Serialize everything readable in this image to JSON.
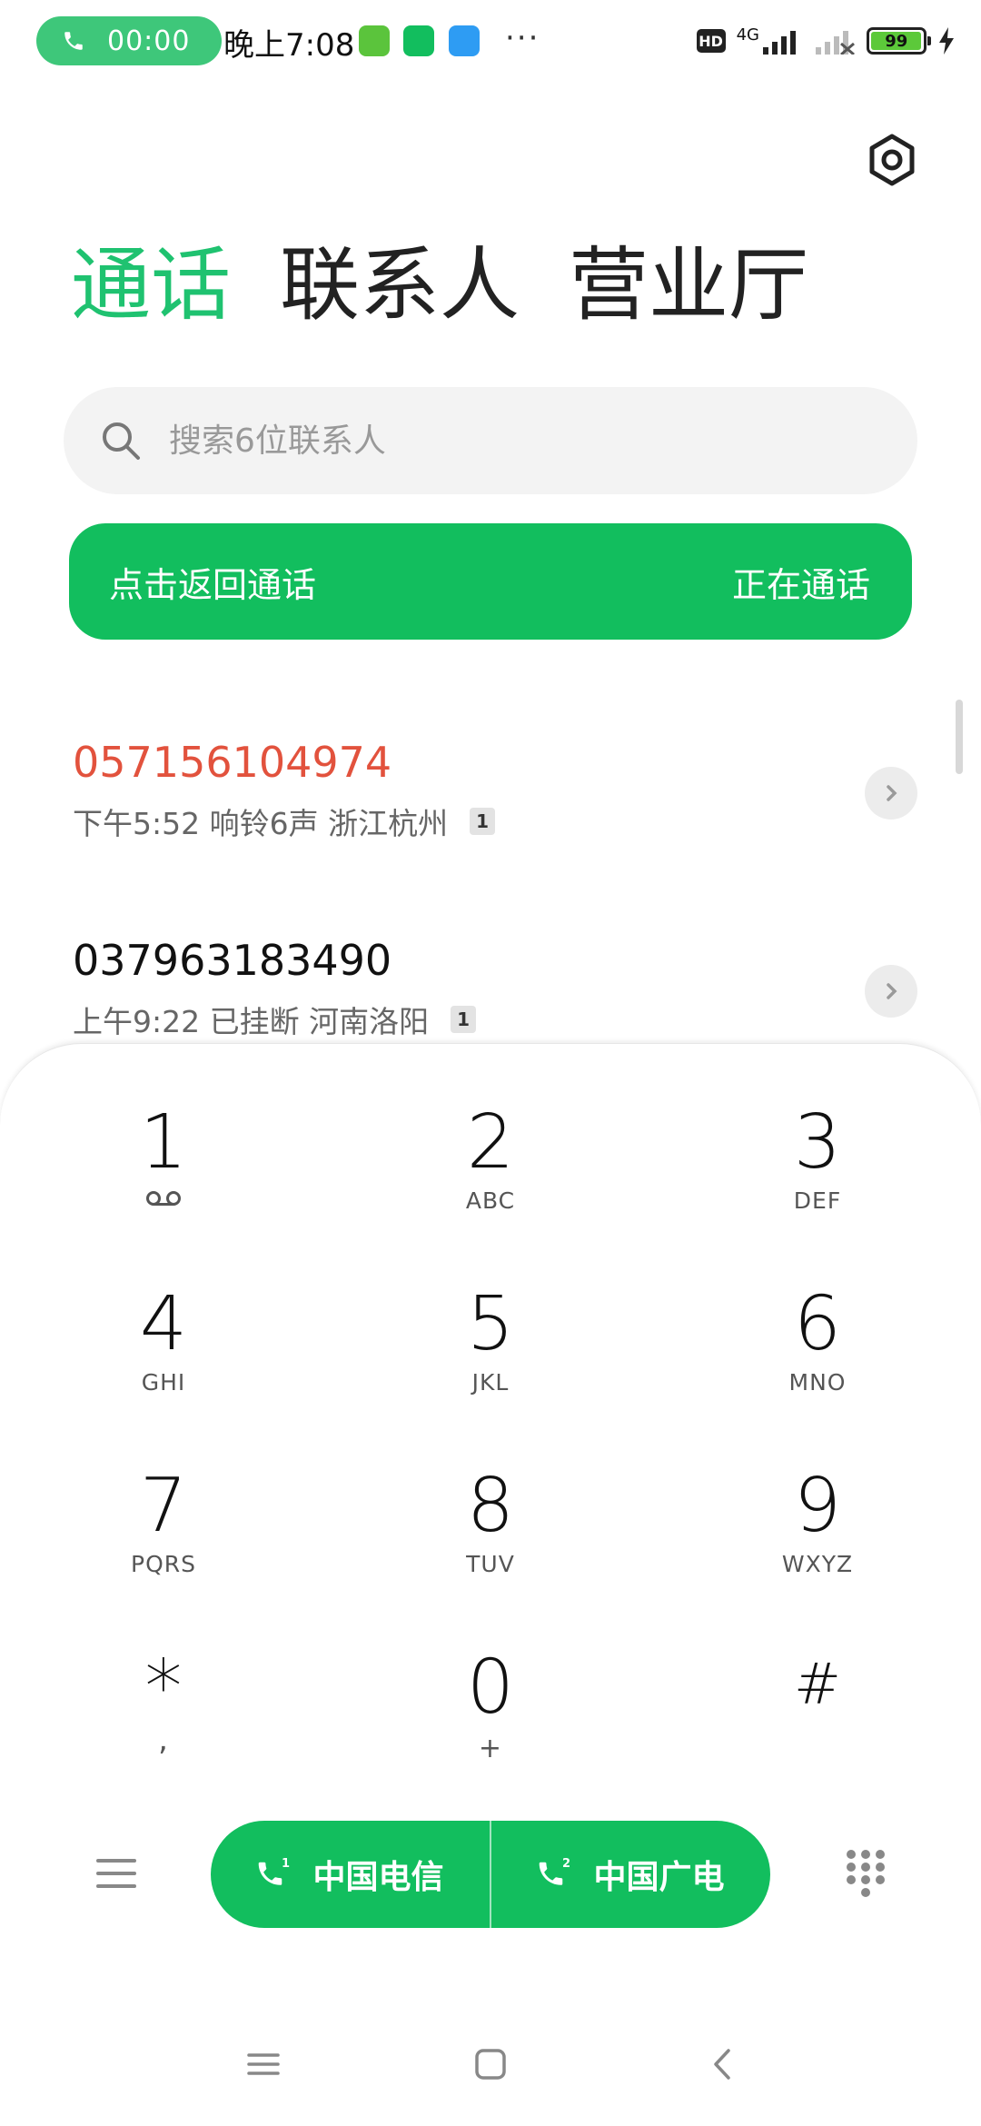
{
  "status_bar": {
    "call_timer": "00:00",
    "time": "晚上7:08",
    "overflow": "···",
    "network": "4G",
    "battery": "99",
    "battery_level_percent": 99,
    "hd": "HD"
  },
  "tabs": [
    {
      "label": "通话",
      "active": true
    },
    {
      "label": "联系人",
      "active": false
    },
    {
      "label": "营业厅",
      "active": false
    }
  ],
  "search": {
    "placeholder": "搜索6位联系人"
  },
  "call_banner": {
    "left": "点击返回通话",
    "right": "正在通话"
  },
  "calls": [
    {
      "number": "057156104974",
      "meta": "下午5:52 响铃6声 浙江杭州",
      "sim": "1",
      "missed": true
    },
    {
      "number": "037963183490",
      "meta": "上午9:22 已挂断 河南洛阳",
      "sim": "1",
      "missed": false
    }
  ],
  "dialpad": [
    {
      "digit": "1",
      "letters": ""
    },
    {
      "digit": "2",
      "letters": "ABC"
    },
    {
      "digit": "3",
      "letters": "DEF"
    },
    {
      "digit": "4",
      "letters": "GHI"
    },
    {
      "digit": "5",
      "letters": "JKL"
    },
    {
      "digit": "6",
      "letters": "MNO"
    },
    {
      "digit": "7",
      "letters": "PQRS"
    },
    {
      "digit": "8",
      "letters": "TUV"
    },
    {
      "digit": "9",
      "letters": "WXYZ"
    },
    {
      "digit": "*",
      "letters": ","
    },
    {
      "digit": "0",
      "letters": "+"
    },
    {
      "digit": "#",
      "letters": ""
    }
  ],
  "sim_buttons": [
    {
      "label": "中国电信",
      "sim": "1"
    },
    {
      "label": "中国广电",
      "sim": "2"
    }
  ],
  "colors": {
    "accent": "#12be5e",
    "missed": "#e2523d",
    "tab_active": "#1fc270"
  }
}
